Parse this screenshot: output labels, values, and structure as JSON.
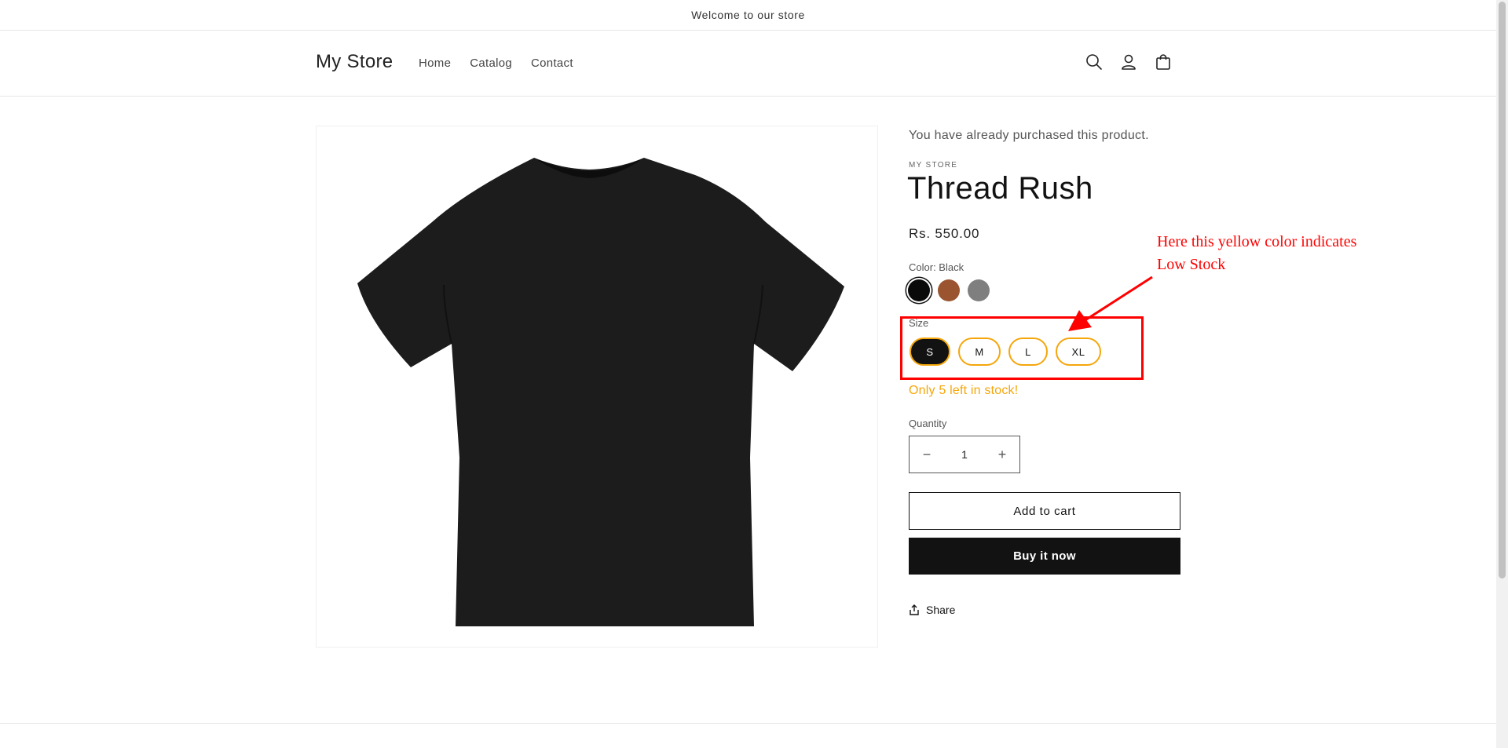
{
  "announcement": {
    "text": "Welcome to our store"
  },
  "header": {
    "logo": "My Store",
    "nav": [
      {
        "label": "Home"
      },
      {
        "label": "Catalog"
      },
      {
        "label": "Contact"
      }
    ],
    "icons": [
      "search-icon",
      "account-icon",
      "cart-icon"
    ]
  },
  "product": {
    "purchased_notice": "You have already purchased this product.",
    "vendor": "MY STORE",
    "title": "Thread Rush",
    "price": "Rs. 550.00",
    "color_label": "Color: Black",
    "colors": [
      {
        "name": "Black",
        "hex": "#0a0a0a",
        "selected": true
      },
      {
        "name": "Brown",
        "hex": "#9a5530",
        "selected": false
      },
      {
        "name": "Gray",
        "hex": "#7f7f7f",
        "selected": false
      }
    ],
    "size_label": "Size",
    "sizes": [
      {
        "label": "S",
        "selected": true
      },
      {
        "label": "M",
        "selected": false
      },
      {
        "label": "L",
        "selected": false
      },
      {
        "label": "XL",
        "selected": false
      }
    ],
    "stock_message": "Only 5 left in stock!",
    "quantity_label": "Quantity",
    "quantity": "1",
    "qty_minus": "−",
    "qty_plus": "+",
    "add_to_cart": "Add to cart",
    "buy_now": "Buy it now",
    "share": "Share"
  },
  "annotation": {
    "line1": "Here this yellow color indicates",
    "line2": "Low Stock"
  },
  "colors": {
    "low_stock": "#f5a60a",
    "annotation": "#ff0000",
    "primary": "#121212"
  }
}
